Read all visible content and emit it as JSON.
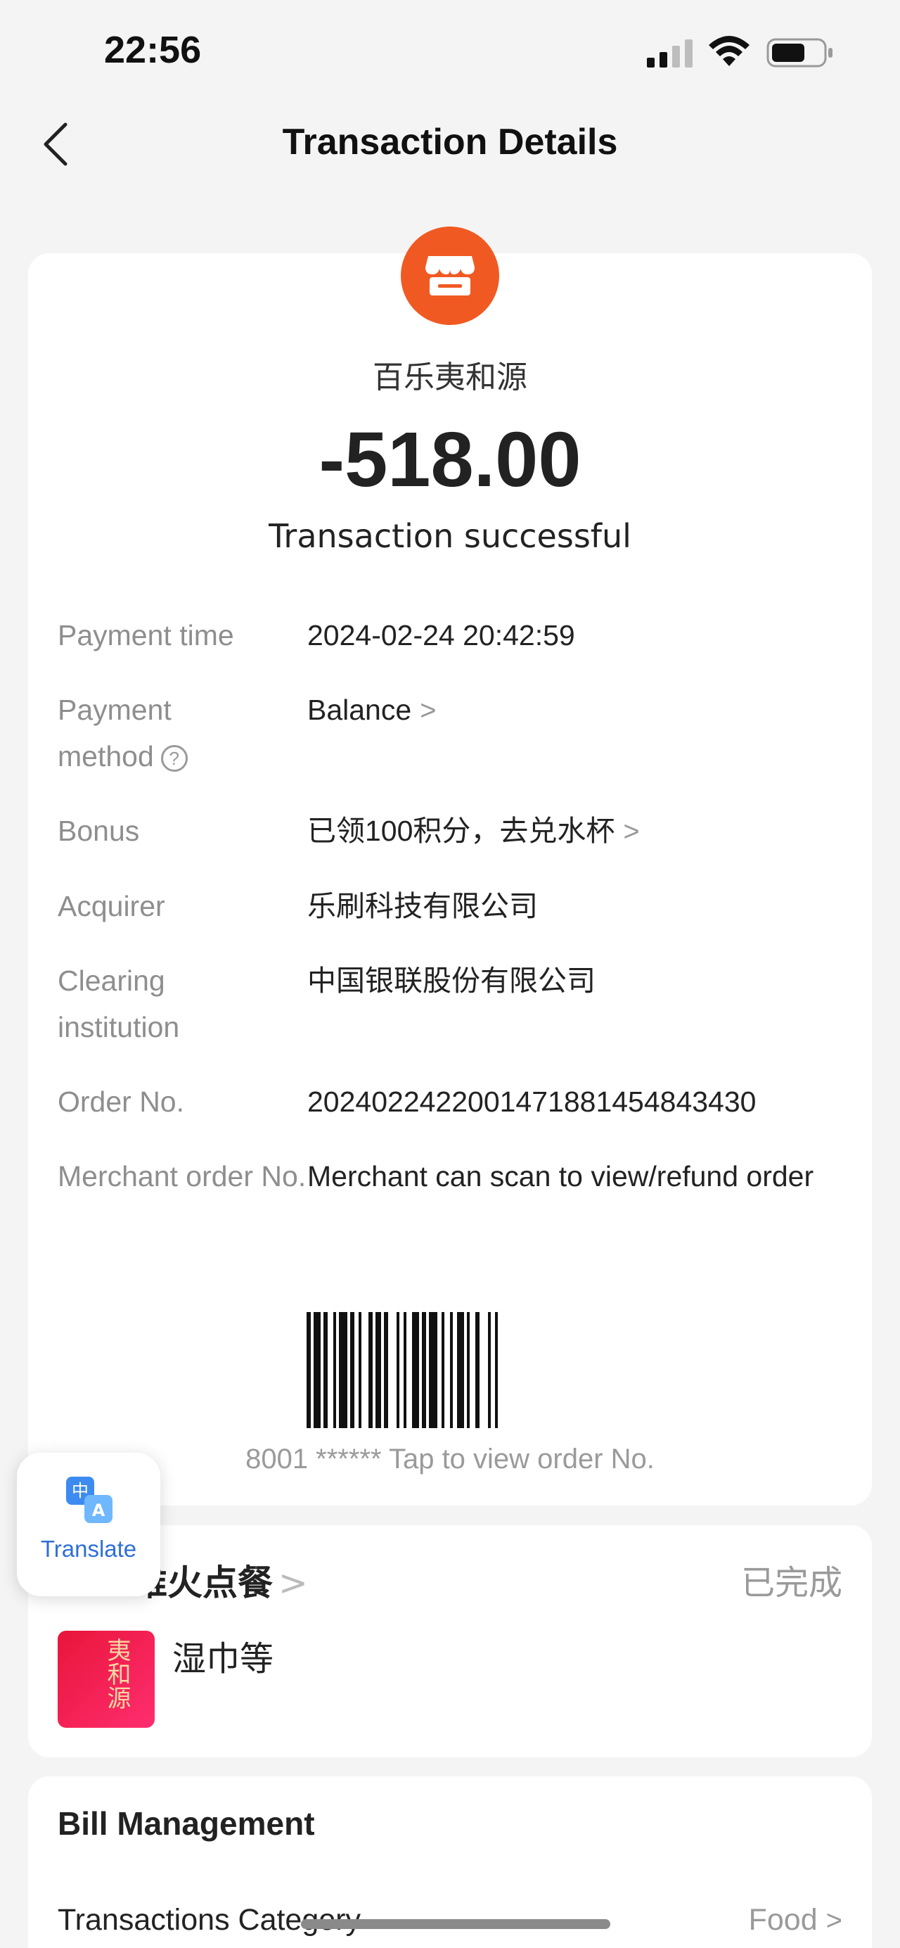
{
  "status_bar": {
    "time": "22:56",
    "icons": [
      "signal-icon",
      "wifi-icon",
      "battery-icon"
    ]
  },
  "header": {
    "title": "Transaction Details",
    "back_icon": "chevron-left-icon"
  },
  "transaction": {
    "merchant_icon": "store-icon",
    "merchant_icon_color": "#f05a22",
    "merchant_name": "百乐夷和源",
    "amount": "-518.00",
    "status": "Transaction successful",
    "details": [
      {
        "label": "Payment time",
        "value": "2024-02-24 20:42:59"
      },
      {
        "label": "Payment method",
        "value": "Balance"
      },
      {
        "label": "Bonus",
        "value": "已领100积分，去兑水杯"
      },
      {
        "label": "Acquirer",
        "value": "乐刷科技有限公司"
      },
      {
        "label": "Clearing institution",
        "value": "中国银联股份有限公司"
      },
      {
        "label": "Order No.",
        "value": "2024022422001471881454843430"
      },
      {
        "label": "Merchant order No.",
        "value": "Merchant can scan to view/refund order"
      }
    ],
    "barcode_caption": "8001 ****** Tap to view order No."
  },
  "order": {
    "title": "维火点餐",
    "status": "已完成",
    "item_name": "湿巾等",
    "thumb_text": "夷和源"
  },
  "translate": {
    "label": "Translate",
    "icon": "translate-icon"
  },
  "bill_management": {
    "title": "Bill Management",
    "category_label": "Transactions Category",
    "category_value": "Food"
  },
  "colors": {
    "accent_orange": "#f05a22",
    "link_blue": "#2f6fd6",
    "muted_gray": "#8e8e8e"
  }
}
